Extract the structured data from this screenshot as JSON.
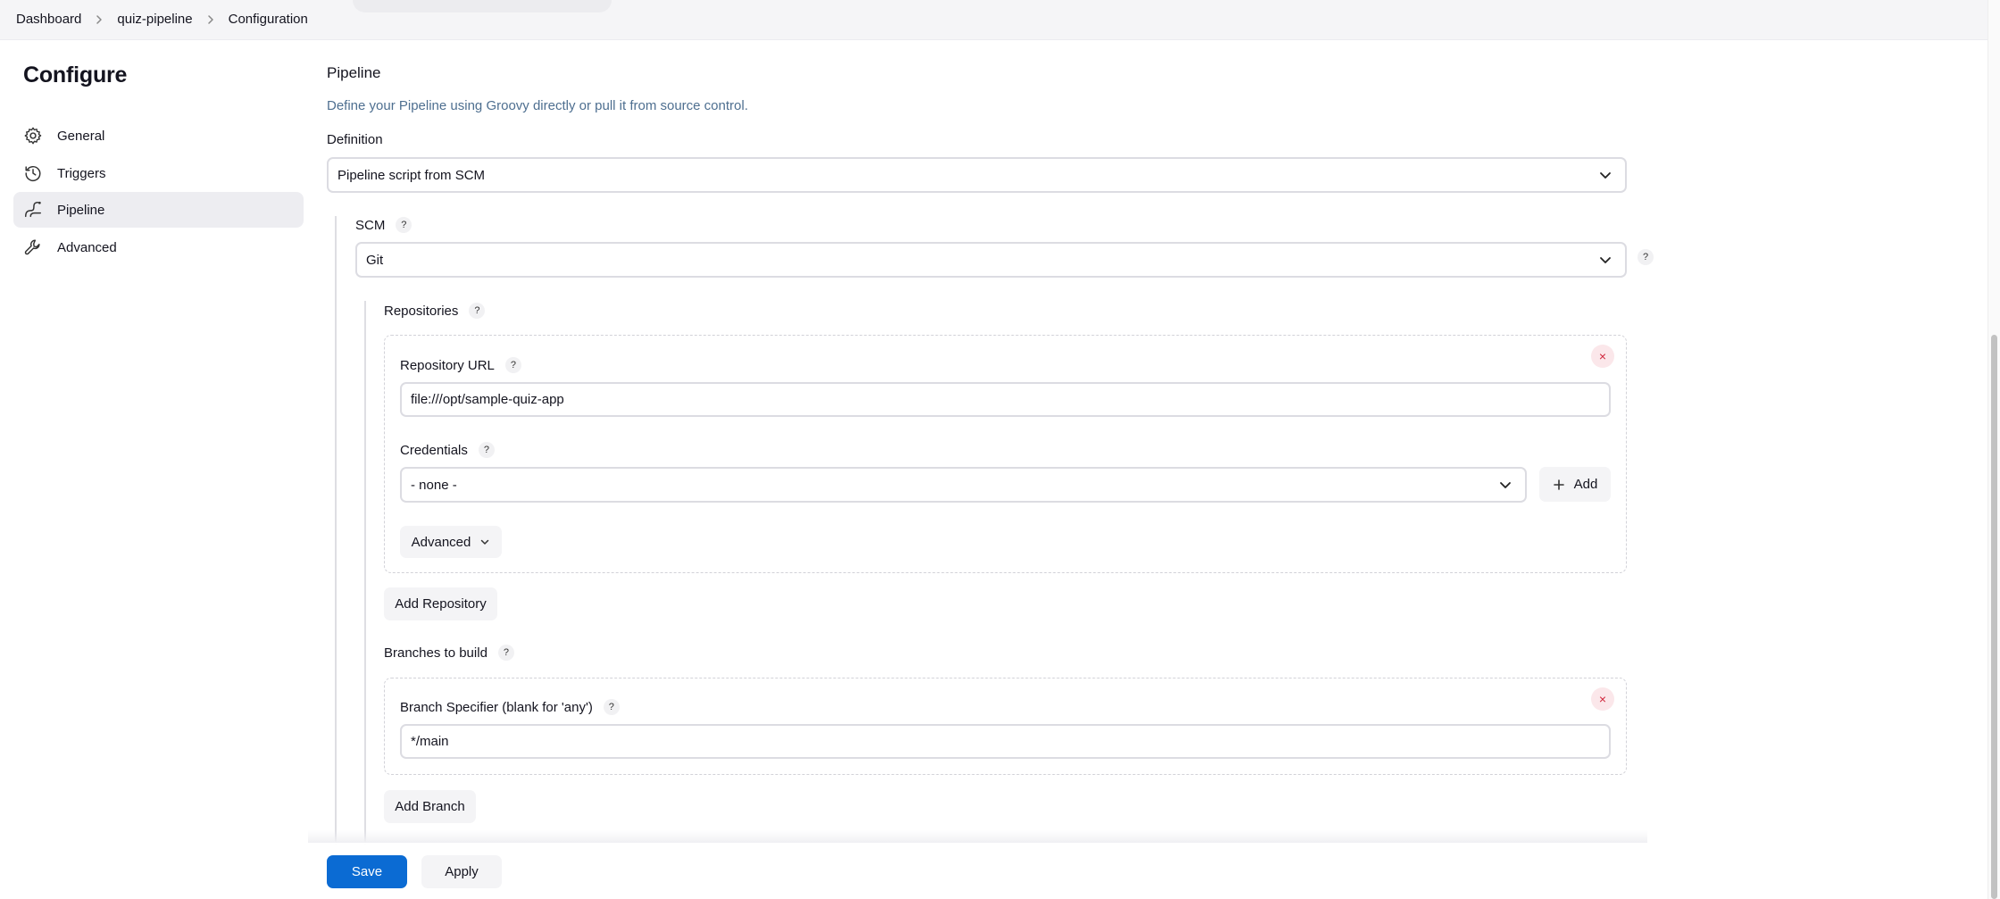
{
  "breadcrumb": {
    "items": [
      "Dashboard",
      "quiz-pipeline",
      "Configuration"
    ]
  },
  "sidebar": {
    "title": "Configure",
    "items": [
      {
        "label": "General",
        "icon": "gear-icon"
      },
      {
        "label": "Triggers",
        "icon": "clock-icon"
      },
      {
        "label": "Pipeline",
        "icon": "pipeline-icon",
        "active": true
      },
      {
        "label": "Advanced",
        "icon": "wrench-icon"
      }
    ]
  },
  "pipeline": {
    "heading": "Pipeline",
    "description": "Define your Pipeline using Groovy directly or pull it from source control.",
    "definition_label": "Definition",
    "definition_value": "Pipeline script from SCM",
    "scm_label": "SCM",
    "scm_value": "Git",
    "help_glyph": "?",
    "repositories": {
      "label": "Repositories",
      "repo_url_label": "Repository URL",
      "repo_url_value": "file:///opt/sample-quiz-app",
      "credentials_label": "Credentials",
      "credentials_value": "- none -",
      "add_credentials_label": "Add",
      "advanced_label": "Advanced",
      "add_repository_label": "Add Repository"
    },
    "branches": {
      "label": "Branches to build",
      "specifier_label": "Branch Specifier (blank for 'any')",
      "specifier_value": "*/main",
      "add_branch_label": "Add Branch"
    },
    "remove_glyph": "×"
  },
  "actions": {
    "save_label": "Save",
    "apply_label": "Apply"
  },
  "colors": {
    "primary": "#0b6bd3",
    "description": "#4e6f90",
    "remove": "#d0253b"
  }
}
